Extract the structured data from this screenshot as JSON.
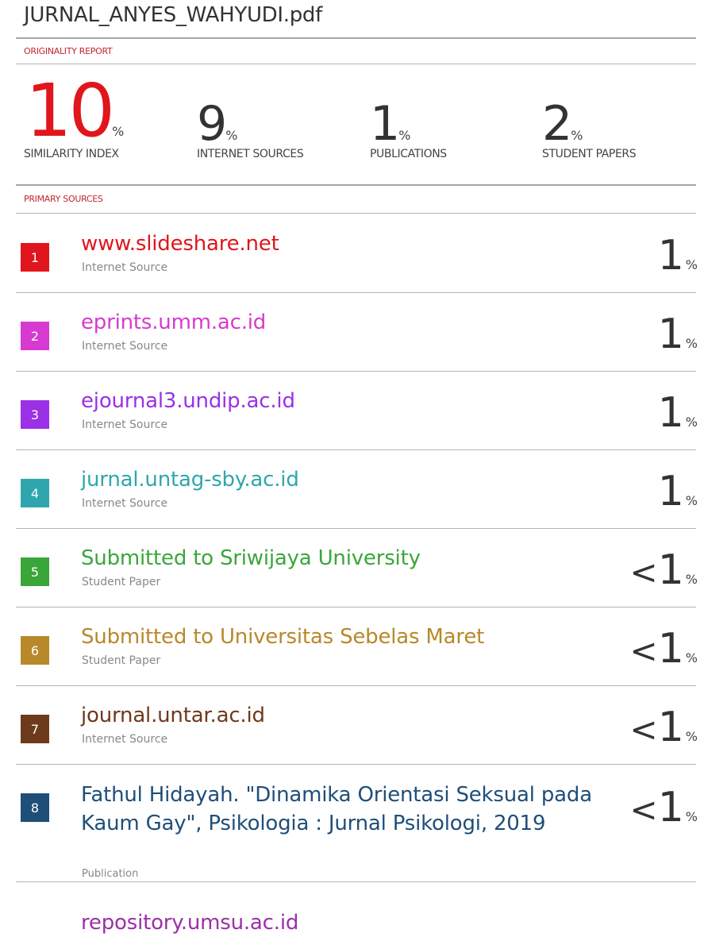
{
  "document": {
    "title": "JURNAL_ANYES_WAHYUDI.pdf"
  },
  "originality_report": {
    "label": "ORIGINALITY REPORT",
    "stats": [
      {
        "value": "10",
        "unit": "%",
        "label": "SIMILARITY INDEX"
      },
      {
        "value": "9",
        "unit": "%",
        "label": "INTERNET SOURCES"
      },
      {
        "value": "1",
        "unit": "%",
        "label": "PUBLICATIONS"
      },
      {
        "value": "2",
        "unit": "%",
        "label": "STUDENT PAPERS"
      }
    ],
    "colors": {
      "similarity_index": "#e0161c",
      "section_label": "#c1272d"
    }
  },
  "primary_sources": {
    "label": "PRIMARY SOURCES",
    "items": [
      {
        "rank": "1",
        "name": "www.slideshare.net",
        "kind": "Internet Source",
        "prefix": "",
        "match": "1",
        "unit": "%",
        "color": "#e0161c"
      },
      {
        "rank": "2",
        "name": "eprints.umm.ac.id",
        "kind": "Internet Source",
        "prefix": "",
        "match": "1",
        "unit": "%",
        "color": "#d63ad1"
      },
      {
        "rank": "3",
        "name": "ejournal3.undip.ac.id",
        "kind": "Internet Source",
        "prefix": "",
        "match": "1",
        "unit": "%",
        "color": "#9b30e6"
      },
      {
        "rank": "4",
        "name": "jurnal.untag-sby.ac.id",
        "kind": "Internet Source",
        "prefix": "",
        "match": "1",
        "unit": "%",
        "color": "#2fa6ad"
      },
      {
        "rank": "5",
        "name": "Submitted to Sriwijaya University",
        "kind": "Student Paper",
        "prefix": "<",
        "match": "1",
        "unit": "%",
        "color": "#3aa63a"
      },
      {
        "rank": "6",
        "name": "Submitted to Universitas Sebelas Maret",
        "kind": "Student Paper",
        "prefix": "<",
        "match": "1",
        "unit": "%",
        "color": "#b8892a"
      },
      {
        "rank": "7",
        "name": "journal.untar.ac.id",
        "kind": "Internet Source",
        "prefix": "<",
        "match": "1",
        "unit": "%",
        "color": "#6e3a1c"
      },
      {
        "rank": "8",
        "name": "Fathul Hidayah. \"Dinamika Orientasi Seksual pada Kaum Gay\", Psikologia : Jurnal Psikologi, 2019",
        "kind": "Publication",
        "prefix": "<",
        "match": "1",
        "unit": "%",
        "color": "#1f4e79"
      },
      {
        "rank": "",
        "name": "repository.umsu.ac.id",
        "kind": "",
        "prefix": "",
        "match": "",
        "unit": "",
        "color": "#9b30a8"
      }
    ]
  }
}
